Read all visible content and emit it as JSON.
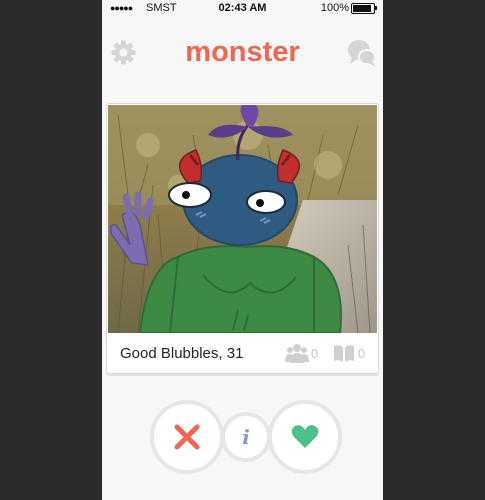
{
  "status_bar": {
    "signal": "●●●●●",
    "carrier": "SMST",
    "time": "02:43 AM",
    "battery_percent": "100%",
    "battery_level": 1.0
  },
  "header": {
    "settings_icon": "gear-icon",
    "app_logo": "monster",
    "messages_icon": "chat-bubbles-icon"
  },
  "profile_card": {
    "caption": "Good Blubbles, 31",
    "friends_icon": "group-icon",
    "friends_count": "0",
    "interests_icon": "book-icon",
    "interests_count": "0"
  },
  "actions": {
    "dislike_icon": "x-icon",
    "info_icon": "info-icon",
    "info_glyph": "i",
    "like_icon": "heart-icon"
  },
  "colors": {
    "brand": "#f2654f",
    "dislike": "#f2654f",
    "like": "#4fc08c",
    "info": "#8a96c8"
  }
}
